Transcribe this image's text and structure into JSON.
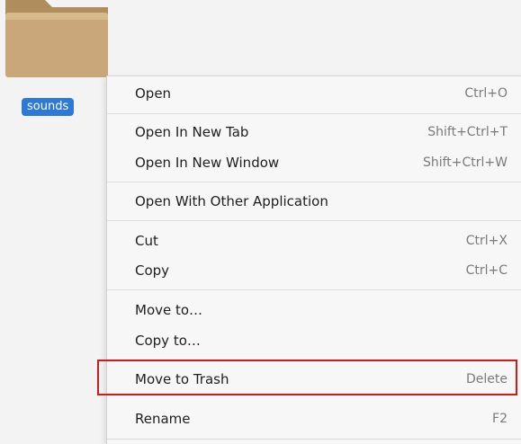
{
  "desktop": {
    "file_label": "sounds"
  },
  "context_menu": {
    "items": [
      {
        "label": "Open",
        "shortcut": "Ctrl+O"
      },
      {
        "label": "Open In New Tab",
        "shortcut": "Shift+Ctrl+T"
      },
      {
        "label": "Open In New Window",
        "shortcut": "Shift+Ctrl+W"
      },
      {
        "label": "Open With Other Application",
        "shortcut": ""
      },
      {
        "label": "Cut",
        "shortcut": "Ctrl+X"
      },
      {
        "label": "Copy",
        "shortcut": "Ctrl+C"
      },
      {
        "label": "Move to…",
        "shortcut": ""
      },
      {
        "label": "Copy to…",
        "shortcut": ""
      },
      {
        "label": "Move to Trash",
        "shortcut": "Delete"
      },
      {
        "label": "Rename",
        "shortcut": "F2"
      }
    ]
  },
  "colors": {
    "selection_blue": "#2f79d6",
    "highlight_red": "#d11a1a",
    "folder_tan": "#c9a77a"
  }
}
